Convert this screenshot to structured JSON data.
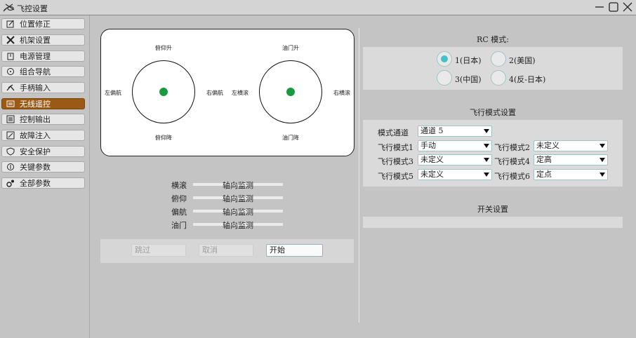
{
  "window": {
    "title": "飞控设置"
  },
  "sidebar": {
    "items": [
      {
        "label": "位置修正",
        "icon": "edit-icon"
      },
      {
        "label": "机架设置",
        "icon": "frame-icon"
      },
      {
        "label": "电源管理",
        "icon": "power-icon"
      },
      {
        "label": "组合导航",
        "icon": "navigation-icon"
      },
      {
        "label": "手柄输入",
        "icon": "gamepad-icon"
      },
      {
        "label": "无线遥控",
        "icon": "remote-icon",
        "active": true
      },
      {
        "label": "控制输出",
        "icon": "output-icon"
      },
      {
        "label": "故障注入",
        "icon": "fault-icon"
      },
      {
        "label": "安全保护",
        "icon": "shield-icon"
      },
      {
        "label": "关键参数",
        "icon": "key-param-icon"
      },
      {
        "label": "全部参数",
        "icon": "all-params-icon"
      }
    ]
  },
  "sticks": {
    "left": {
      "top": "俯仰升",
      "bottom": "俯仰降",
      "left": "左偏航",
      "right": "右偏航"
    },
    "right": {
      "top": "油门升",
      "bottom": "油门降",
      "left": "左横滚",
      "right": "右横滚"
    }
  },
  "monitor": {
    "rows": [
      {
        "label": "横滚",
        "text": "轴向监测"
      },
      {
        "label": "俯仰",
        "text": "轴向监测"
      },
      {
        "label": "偏航",
        "text": "轴向监测"
      },
      {
        "label": "油门",
        "text": "轴向监测"
      }
    ]
  },
  "actions": {
    "skip": "跳过",
    "cancel": "取消",
    "start": "开始"
  },
  "rc_mode": {
    "title": "RC 模式:",
    "options": [
      "1(日本)",
      "2(美国)",
      "3(中国)",
      "4(反-日本)"
    ],
    "selected_index": 0
  },
  "flight_modes": {
    "title": "飞行模式设置",
    "channel_label": "模式通道",
    "channel_value": "通道 5",
    "modes": [
      {
        "label": "飞行模式1",
        "value": "手动"
      },
      {
        "label": "飞行模式2",
        "value": "未定义"
      },
      {
        "label": "飞行模式3",
        "value": "未定义"
      },
      {
        "label": "飞行模式4",
        "value": "定高"
      },
      {
        "label": "飞行模式5",
        "value": "未定义"
      },
      {
        "label": "飞行模式6",
        "value": "定点"
      }
    ]
  },
  "switch_settings": {
    "title": "开关设置"
  },
  "colors": {
    "active_nav": "#9a5a14",
    "stick_dot": "#1a9a40",
    "radio_selected": "#44c2c8"
  }
}
